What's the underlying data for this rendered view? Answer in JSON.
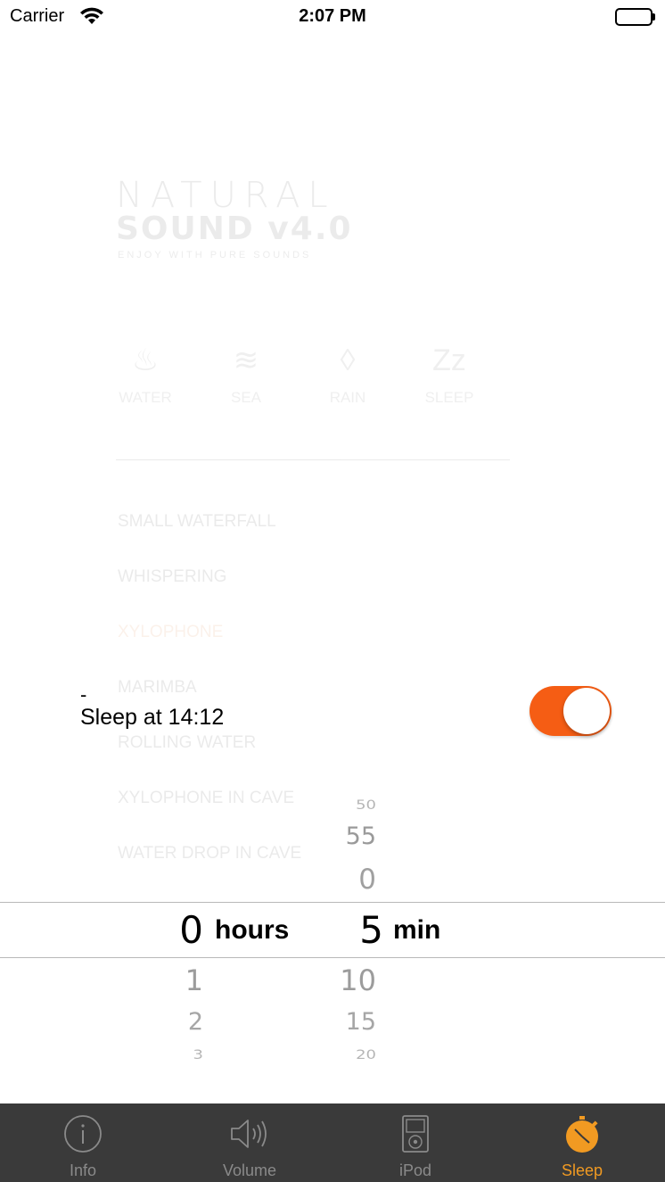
{
  "status_bar": {
    "carrier": "Carrier",
    "time": "2:07 PM"
  },
  "background_app": {
    "logo_title": "NATURAL",
    "logo_subtitle": "SOUND v4.0",
    "logo_tagline": "ENJOY WITH PURE SOUNDS",
    "categories": [
      {
        "label": "WATER",
        "icon": "water-icon"
      },
      {
        "label": "SEA",
        "icon": "sea-waves-icon"
      },
      {
        "label": "RAIN",
        "icon": "raindrop-icon"
      },
      {
        "label": "SLEEP",
        "icon": "sleep-zzz-icon"
      }
    ],
    "sounds": [
      "SMALL WATERFALL",
      "WHISPERING",
      "XYLOPHONE",
      "MARIMBA",
      "ROLLING WATER",
      "XYLOPHONE IN CAVE",
      "WATER DROP IN CAVE"
    ],
    "active_sound": "XYLOPHONE"
  },
  "sleep": {
    "dash": "-",
    "sleep_at": "Sleep at 14:12",
    "toggle_on": true,
    "toggle_color": "#f55d14"
  },
  "picker": {
    "hours_above": [],
    "hours_selected": "0",
    "hours_unit": "hours",
    "hours_below": [
      "1",
      "2",
      "3"
    ],
    "minutes_above": [
      "50",
      "55",
      "0"
    ],
    "minutes_selected": "5",
    "minutes_unit": "min",
    "minutes_below": [
      "10",
      "15",
      "20"
    ]
  },
  "tab_bar": {
    "tabs": [
      {
        "label": "Info",
        "icon": "info-icon"
      },
      {
        "label": "Volume",
        "icon": "speaker-icon"
      },
      {
        "label": "iPod",
        "icon": "ipod-icon"
      },
      {
        "label": "Sleep",
        "icon": "stopwatch-icon"
      }
    ],
    "active_tab": "Sleep",
    "active_color": "#f19a22",
    "inactive_color": "#8a8a8a",
    "background": "#3a3a3a"
  }
}
